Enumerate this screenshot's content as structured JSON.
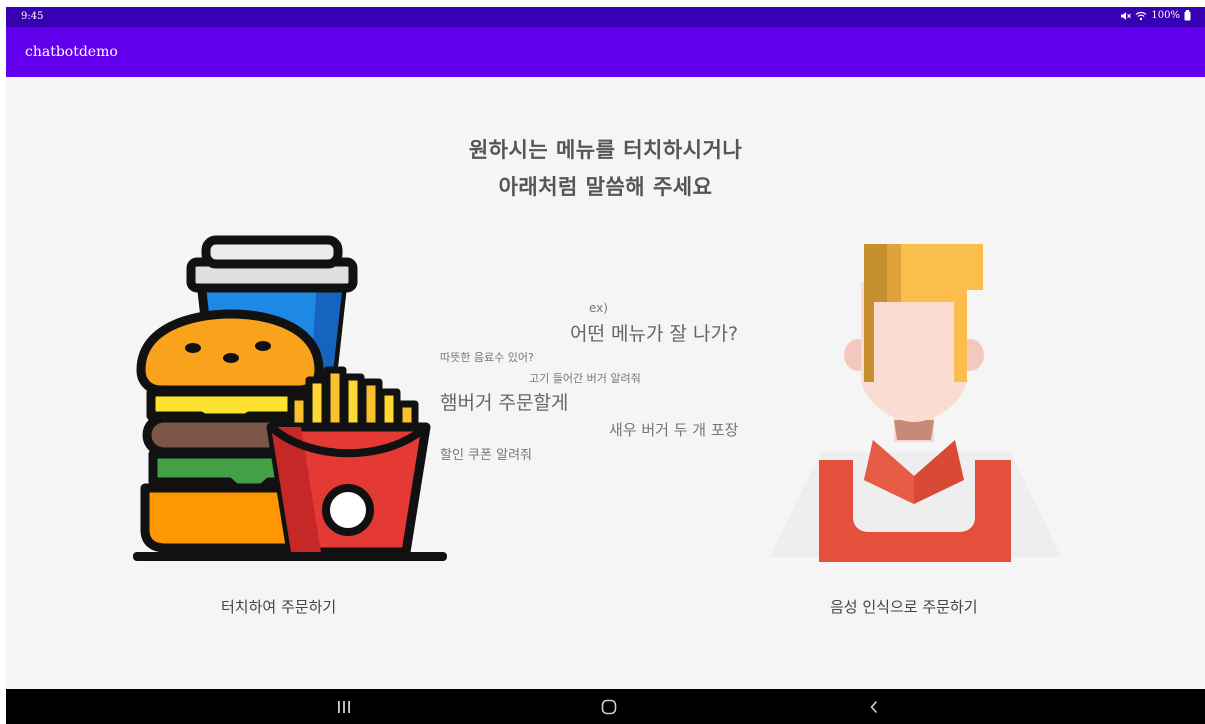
{
  "status_bar": {
    "time": "9:45",
    "battery": "100%"
  },
  "app_bar": {
    "title": "chatbotdemo"
  },
  "headline": {
    "line1": "원하시는 메뉴를 터치하시거나",
    "line2": "아래처럼 말씀해 주세요"
  },
  "examples": {
    "prefix": "ex)",
    "items": [
      "어떤 메뉴가 잘 나가?",
      "따뜻한 음료수 있어?",
      "고기 들어간 버거 알려줘",
      "햄버거 주문할게",
      "새우 버거 두 개 포장",
      "할인 쿠폰 알려줘"
    ]
  },
  "options": {
    "touch": {
      "label": "터치하여 주문하기"
    },
    "voice": {
      "label": "음성 인식으로 주문하기"
    }
  },
  "nav": {
    "recents": "recents",
    "home": "home",
    "back": "back"
  },
  "colors": {
    "status_bar": "#3700b3",
    "app_bar": "#6200ee",
    "background": "#f5f5f5"
  }
}
